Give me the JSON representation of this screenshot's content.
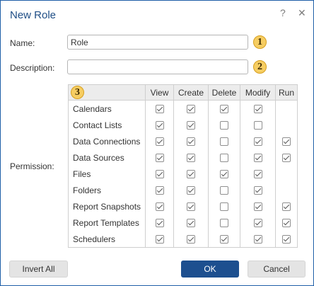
{
  "dialog": {
    "title": "New Role",
    "help_glyph": "?",
    "close_glyph": "✕"
  },
  "form": {
    "name_label": "Name:",
    "name_value": "Role",
    "description_label": "Description:",
    "description_value": "",
    "permission_label": "Permission:"
  },
  "badges": [
    "1",
    "2",
    "3"
  ],
  "permissions": {
    "columns": [
      "View",
      "Create",
      "Delete",
      "Modify",
      "Run"
    ],
    "rows": [
      {
        "name": "Calendars",
        "view": true,
        "create": true,
        "delete": true,
        "modify": true,
        "run": null
      },
      {
        "name": "Contact Lists",
        "view": true,
        "create": true,
        "delete": false,
        "modify": false,
        "run": null
      },
      {
        "name": "Data Connections",
        "view": true,
        "create": true,
        "delete": false,
        "modify": true,
        "run": true
      },
      {
        "name": "Data Sources",
        "view": true,
        "create": true,
        "delete": false,
        "modify": true,
        "run": true
      },
      {
        "name": "Files",
        "view": true,
        "create": true,
        "delete": true,
        "modify": true,
        "run": null
      },
      {
        "name": "Folders",
        "view": true,
        "create": true,
        "delete": false,
        "modify": true,
        "run": null
      },
      {
        "name": "Report Snapshots",
        "view": true,
        "create": true,
        "delete": false,
        "modify": true,
        "run": true
      },
      {
        "name": "Report Templates",
        "view": true,
        "create": true,
        "delete": false,
        "modify": true,
        "run": true
      },
      {
        "name": "Schedulers",
        "view": true,
        "create": true,
        "delete": true,
        "modify": true,
        "run": true
      }
    ]
  },
  "buttons": {
    "invert_all": "Invert All",
    "ok": "OK",
    "cancel": "Cancel"
  },
  "colors": {
    "title": "#1f4e86",
    "primary_button": "#1d4f8f",
    "badge": "#f6cd62"
  },
  "icons": {
    "help": "help-icon",
    "close": "close-icon",
    "check": "check-icon"
  }
}
